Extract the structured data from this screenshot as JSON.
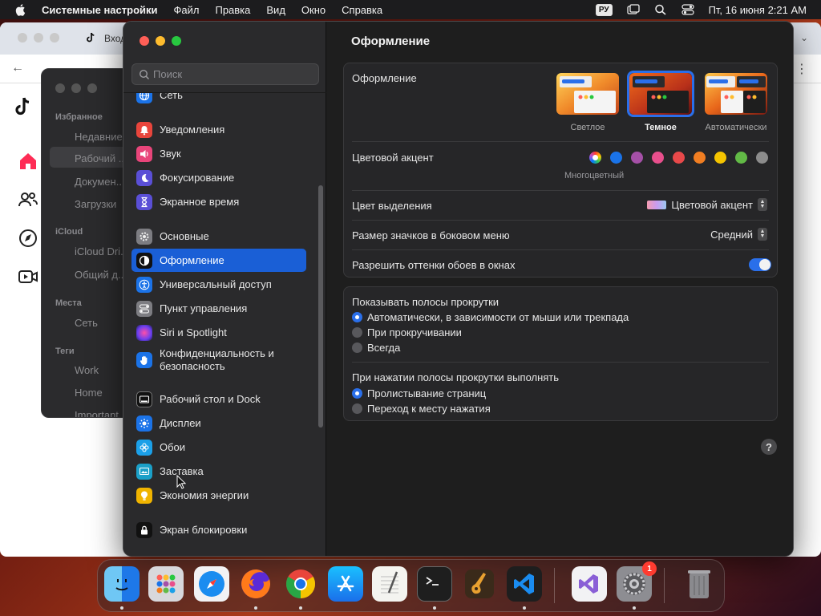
{
  "menubar": {
    "app_name": "Системные настройки",
    "menus": [
      "Файл",
      "Правка",
      "Вид",
      "Окно",
      "Справка"
    ],
    "input_source": "РУ",
    "datetime": "Пт, 16 июня  2:21 AM"
  },
  "browser": {
    "tab_title": "Вход"
  },
  "finder": {
    "sections": {
      "favorites": "Избранное",
      "icloud": "iCloud",
      "places": "Места",
      "tags": "Теги"
    },
    "favorites": [
      "Недавние",
      "Рабочий ...",
      "Докумен...",
      "Загрузки"
    ],
    "icloud_items": [
      "iCloud Dri...",
      "Общий д..."
    ],
    "places_items": [
      "Сеть"
    ],
    "tags_items": [
      "Work",
      "Home",
      "Important"
    ]
  },
  "sidebar": {
    "search_placeholder": "Поиск",
    "items": [
      {
        "label": "Сеть",
        "icon": "globe-icon",
        "color": "#1b73e8"
      },
      {
        "label": "Уведомления",
        "icon": "bell-icon",
        "color": "#e8453c"
      },
      {
        "label": "Звук",
        "icon": "speaker-icon",
        "color": "#e8457a"
      },
      {
        "label": "Фокусирование",
        "icon": "moon-icon",
        "color": "#5a4fd6"
      },
      {
        "label": "Экранное время",
        "icon": "hourglass-icon",
        "color": "#5a4fd6"
      },
      {
        "label": "Основные",
        "icon": "gear-icon",
        "color": "#7d7d82"
      },
      {
        "label": "Оформление",
        "icon": "appearance-icon",
        "color": "#111111"
      },
      {
        "label": "Универсальный доступ",
        "icon": "accessibility-icon",
        "color": "#1b73e8"
      },
      {
        "label": "Пункт управления",
        "icon": "control-center-icon",
        "color": "#7d7d82"
      },
      {
        "label": "Siri и Spotlight",
        "icon": "siri-icon",
        "color": "#b84fd6"
      },
      {
        "label": "Конфиденциальность и безопасность",
        "icon": "hand-icon",
        "color": "#1b73e8"
      },
      {
        "label": "Рабочий стол и Dock",
        "icon": "dock-icon",
        "color": "#111111"
      },
      {
        "label": "Дисплеи",
        "icon": "sun-icon",
        "color": "#1b73e8"
      },
      {
        "label": "Обои",
        "icon": "flower-icon",
        "color": "#1ba0e8"
      },
      {
        "label": "Заставка",
        "icon": "screensaver-icon",
        "color": "#1ba0c8"
      },
      {
        "label": "Экономия энергии",
        "icon": "battery-icon",
        "color": "#f0b400"
      },
      {
        "label": "Экран блокировки",
        "icon": "lock-icon",
        "color": "#111111"
      }
    ]
  },
  "content": {
    "title": "Оформление",
    "appearance": {
      "label": "Оформление",
      "options": [
        "Светлое",
        "Темное",
        "Автоматически"
      ],
      "selected": "Темное"
    },
    "accent": {
      "label": "Цветовой акцент",
      "colors": [
        "multicolor",
        "#1a73e8",
        "#a550a7",
        "#e84f8c",
        "#e8494a",
        "#f17e22",
        "#f5c400",
        "#62ba46",
        "#8c8c8c"
      ],
      "caption": "Многоцветный"
    },
    "highlight": {
      "label": "Цвет выделения",
      "value": "Цветовой акцент"
    },
    "icon_size": {
      "label": "Размер значков в боковом меню",
      "value": "Средний"
    },
    "tinting": {
      "label": "Разрешить оттенки обоев в окнах",
      "enabled": true
    },
    "scrollbars": {
      "label": "Показывать полосы прокрутки",
      "options": [
        "Автоматически, в зависимости от мыши или трекпада",
        "При прокручивании",
        "Всегда"
      ],
      "selected": 0
    },
    "click_scroll": {
      "label": "При нажатии полосы прокрутки выполнять",
      "options": [
        "Пролистывание страниц",
        "Переход к месту нажатия"
      ],
      "selected": 0
    },
    "help": "?"
  },
  "dock": {
    "apps": [
      "finder-icon",
      "launchpad-icon",
      "safari-icon",
      "firefox-icon",
      "chrome-icon",
      "app-store-icon",
      "textedit-icon",
      "terminal-icon",
      "garageband-icon",
      "vscode-icon",
      "visual-studio-icon",
      "system-settings-icon",
      "trash-icon"
    ],
    "settings_badge": "1"
  }
}
